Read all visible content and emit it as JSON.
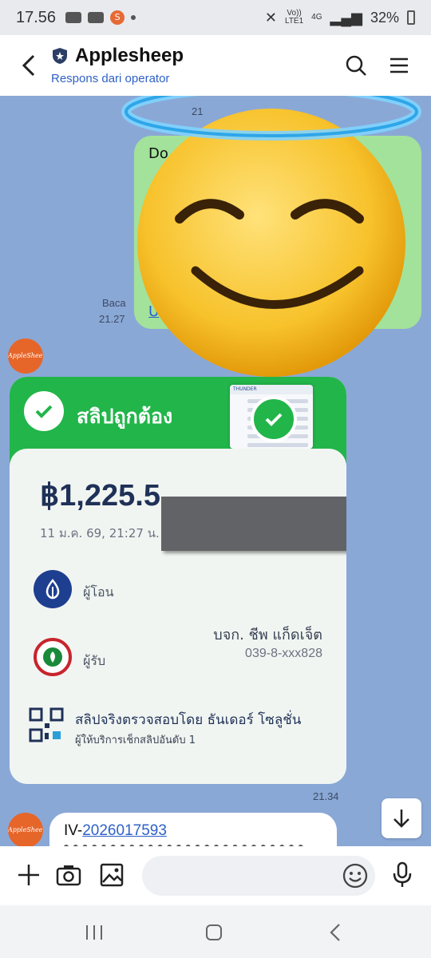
{
  "status_bar": {
    "time": "17.56",
    "lte_top": "Vo))",
    "lte_bottom": "LTE1",
    "net_top": "4G",
    "battery": "32%"
  },
  "header": {
    "title": "Applesheep",
    "subtitle": "Respons dari operator"
  },
  "chat": {
    "outgoing": {
      "text_partial": "Do",
      "link_partial": "U",
      "read_label": "Baca",
      "time": "21.27",
      "top_time": "21"
    },
    "avatar_label": "AppleSheep",
    "slip": {
      "title": "สลิปถูกต้อง",
      "doc_brand": "THUNDER",
      "amount": "฿1,225.5",
      "datetime": "11 ม.ค. 69, 21:27 น.",
      "sender_label": "ผู้โอน",
      "receiver_label": "ผู้รับ",
      "receiver_name": "บจก. ชีพ แก็ดเจ็ต",
      "receiver_account": "039-8-xxx828",
      "verified_by": "สลิปจริงตรวจสอบโดย ธันเดอร์ โซลูชั่น",
      "verified_sub": "ผู้ให้บริการเช็กสลิปอันดับ 1",
      "time": "21.34"
    },
    "incoming": {
      "prefix": "IV-",
      "invoice_link": "2026017593"
    }
  },
  "input": {
    "placeholder": ""
  },
  "colors": {
    "chat_bg": "#8aa8d6",
    "slip_green": "#22b54a",
    "link_blue": "#2f61c7",
    "outgoing_bubble": "#a3e29a"
  },
  "icons": [
    "back-icon",
    "shield-icon",
    "search-icon",
    "menu-icon",
    "plus-icon",
    "camera-icon",
    "image-icon",
    "emoji-icon",
    "mic-icon",
    "scroll-down-icon",
    "recents-icon",
    "home-icon",
    "nav-back-icon"
  ]
}
